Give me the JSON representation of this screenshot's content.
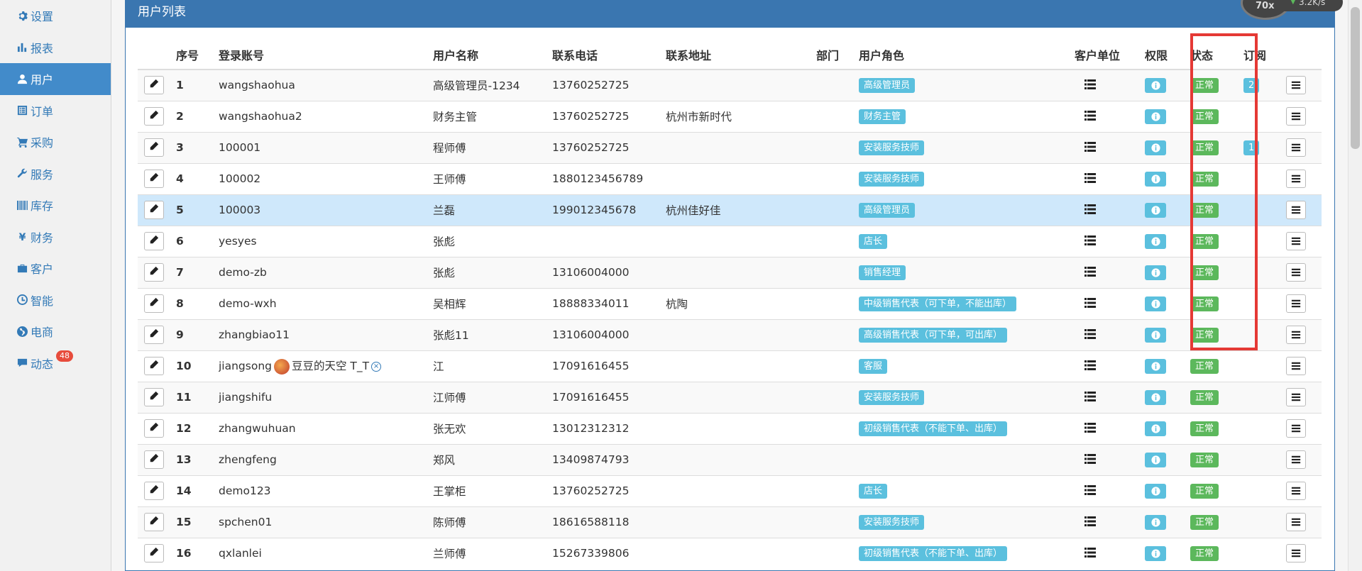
{
  "sidebar": {
    "items": [
      {
        "label": "设置",
        "icon": "gear-icon"
      },
      {
        "label": "报表",
        "icon": "bar-chart-icon"
      },
      {
        "label": "用户",
        "icon": "user-icon"
      },
      {
        "label": "订单",
        "icon": "list-alt-icon"
      },
      {
        "label": "采购",
        "icon": "cart-icon"
      },
      {
        "label": "服务",
        "icon": "wrench-icon"
      },
      {
        "label": "库存",
        "icon": "barcode-icon"
      },
      {
        "label": "财务",
        "icon": "yen-icon"
      },
      {
        "label": "客户",
        "icon": "briefcase-icon"
      },
      {
        "label": "智能",
        "icon": "clock-icon"
      },
      {
        "label": "电商",
        "icon": "globe-icon"
      },
      {
        "label": "动态",
        "icon": "comment-icon",
        "badge": "48"
      }
    ]
  },
  "panel": {
    "title": "用户列表"
  },
  "table": {
    "headers": [
      "序号",
      "登录账号",
      "用户名称",
      "联系电话",
      "联系地址",
      "部门",
      "用户角色",
      "客户单位",
      "权限",
      "状态",
      "订阅"
    ],
    "rows": [
      {
        "no": "1",
        "account": "wangshaohua",
        "name": "高级管理员-1234",
        "phone": "13760252725",
        "address": "",
        "dept": "",
        "role": "高级管理员",
        "status": "正常",
        "sub": "2"
      },
      {
        "no": "2",
        "account": "wangshaohua2",
        "name": "财务主管",
        "phone": "13760252725",
        "address": "杭州市新时代",
        "dept": "",
        "role": "财务主管",
        "status": "正常",
        "sub": ""
      },
      {
        "no": "3",
        "account": "100001",
        "name": "程师傅",
        "phone": "13760252725",
        "address": "",
        "dept": "",
        "role": "安装服务技师",
        "status": "正常",
        "sub": "1"
      },
      {
        "no": "4",
        "account": "100002",
        "name": "王师傅",
        "phone": "1880123456789",
        "address": "",
        "dept": "",
        "role": "安装服务技师",
        "status": "正常",
        "sub": ""
      },
      {
        "no": "5",
        "account": "100003",
        "name": "兰磊",
        "phone": "199012345678",
        "address": "杭州佳好佳",
        "dept": "",
        "role": "高级管理员",
        "status": "正常",
        "sub": ""
      },
      {
        "no": "6",
        "account": "yesyes",
        "name": "张彪",
        "phone": "",
        "address": "",
        "dept": "",
        "role": "店长",
        "status": "正常",
        "sub": ""
      },
      {
        "no": "7",
        "account": "demo-zb",
        "name": "张彪",
        "phone": "13106004000",
        "address": "",
        "dept": "",
        "role": "销售经理",
        "status": "正常",
        "sub": ""
      },
      {
        "no": "8",
        "account": "demo-wxh",
        "name": "吴相辉",
        "phone": "18888334011",
        "address": "杭陶",
        "dept": "",
        "role": "中级销售代表（可下单，不能出库）",
        "status": "正常",
        "sub": ""
      },
      {
        "no": "9",
        "account": "zhangbiao11",
        "name": "张彪11",
        "phone": "13106004000",
        "address": "",
        "dept": "",
        "role": "高级销售代表（可下单，可出库）",
        "status": "正常",
        "sub": ""
      },
      {
        "no": "10",
        "account": "jiangsong",
        "account_extra": "豆豆的天空 T_T",
        "name": "江",
        "phone": "17091616455",
        "address": "",
        "dept": "",
        "role": "客服",
        "status": "正常",
        "sub": ""
      },
      {
        "no": "11",
        "account": "jiangshifu",
        "name": "江师傅",
        "phone": "17091616455",
        "address": "",
        "dept": "",
        "role": "安装服务技师",
        "status": "正常",
        "sub": ""
      },
      {
        "no": "12",
        "account": "zhangwuhuan",
        "name": "张无欢",
        "phone": "13012312312",
        "address": "",
        "dept": "",
        "role": "初级销售代表（不能下单、出库）",
        "status": "正常",
        "sub": ""
      },
      {
        "no": "13",
        "account": "zhengfeng",
        "name": "郑风",
        "phone": "13409874793",
        "address": "",
        "dept": "",
        "role": "",
        "status": "正常",
        "sub": ""
      },
      {
        "no": "14",
        "account": "demo123",
        "name": "王掌柜",
        "phone": "13760252725",
        "address": "",
        "dept": "",
        "role": "店长",
        "status": "正常",
        "sub": ""
      },
      {
        "no": "15",
        "account": "spchen01",
        "name": "陈师傅",
        "phone": "18616588118",
        "address": "",
        "dept": "",
        "role": "安装服务技师",
        "status": "正常",
        "sub": ""
      },
      {
        "no": "16",
        "account": "qxlanlei",
        "name": "兰师傅",
        "phone": "15267339806",
        "address": "",
        "dept": "",
        "role": "初级销售代表（不能下单、出库）",
        "status": "正常",
        "sub": ""
      }
    ]
  },
  "speed_widget": {
    "percent": "70x",
    "rate": "3.2K/s"
  },
  "colors": {
    "primary": "#3a76b0",
    "info": "#5bc0de",
    "success": "#5cb85c",
    "highlight_border": "#e53935"
  }
}
